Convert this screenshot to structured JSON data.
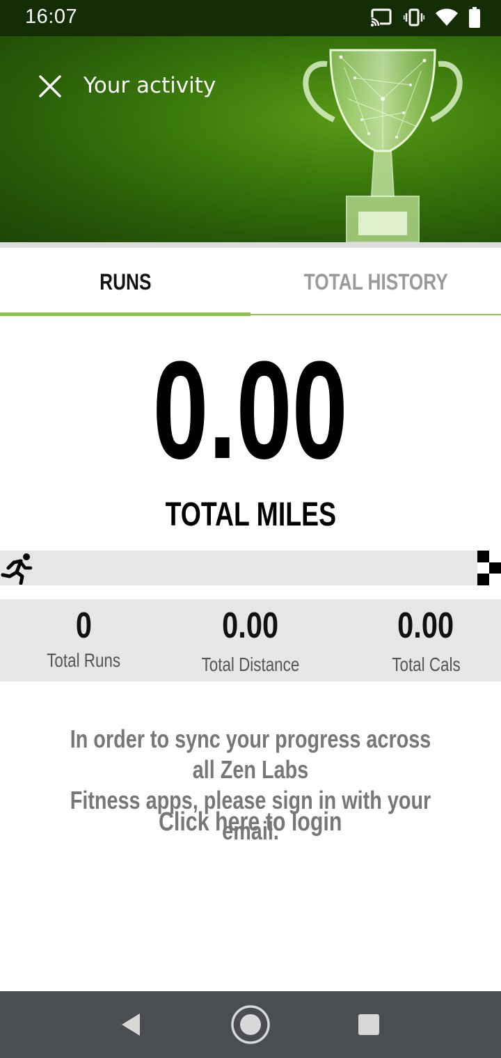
{
  "status_bar": {
    "time": "16:07",
    "icons": [
      "cast-icon",
      "vibrate-icon",
      "wifi-icon",
      "battery-icon"
    ]
  },
  "header": {
    "title": "Your activity",
    "close_icon": "close-icon",
    "banner_image": "trophy-illustration"
  },
  "tabs": [
    {
      "label": "RUNS",
      "active": true
    },
    {
      "label": "TOTAL HISTORY",
      "active": false
    }
  ],
  "summary": {
    "value": "0.00",
    "label": "TOTAL MILES"
  },
  "progress": {
    "fraction": 0,
    "start_icon": "runner-icon",
    "end_icon": "finish-flag-icon"
  },
  "stats": [
    {
      "value": "0",
      "label": "Total Runs"
    },
    {
      "value": "0.00",
      "label": "Total Distance"
    },
    {
      "value": "0.00",
      "label": "Total Cals"
    }
  ],
  "sync": {
    "message_line1": "In order to sync your progress across all Zen Labs",
    "message_line2": "Fitness apps, please sign in with your email.",
    "login_link": "Click here to login"
  },
  "nav_bar": {
    "buttons": [
      "back-icon",
      "home-icon",
      "recents-icon"
    ]
  },
  "colors": {
    "accent": "#8bc34a",
    "header_green": "#3b7a0c",
    "status_bar": "#142d06",
    "nav_bar": "#4a4e52",
    "track_gray": "#e6e6e6"
  }
}
